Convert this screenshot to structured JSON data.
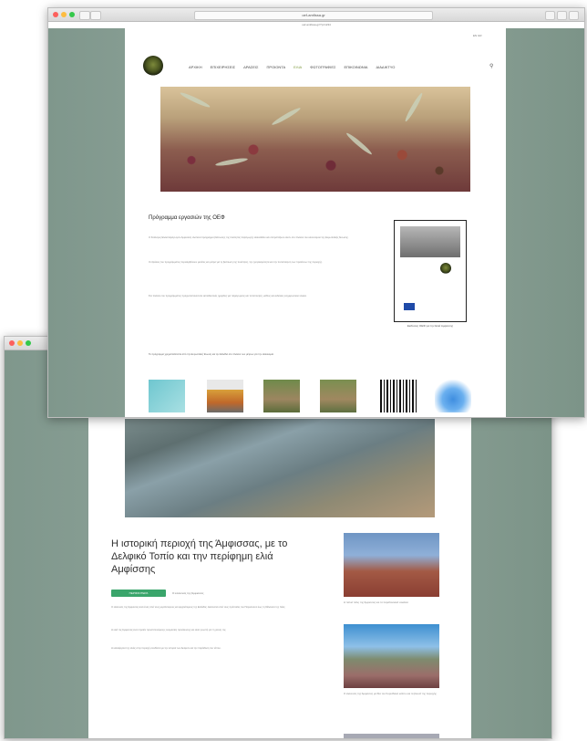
{
  "windows": {
    "front": {
      "url": "oef-amfissa.gr",
      "subtitle": "oef-amfissa.gr/?p=1234"
    },
    "back": {
      "url": ""
    }
  },
  "front_page": {
    "lang": "EN GR",
    "menu": [
      "ΑΡΧΙΚΗ",
      "ΕΠΙΧΕΙΡΗΣΕΙΣ",
      "ΔΡΑΣΕΙΣ",
      "ΠΡΟΙΟΝΤΑ",
      "ΕΛΙΑ",
      "ΦΩΤΟΓΡΑΦΙΕΣ",
      "ΕΠΙΚΟΙΝΩΝΙΑ",
      "ΔΙΑΔΙΚΤΥΟ"
    ],
    "title": "Πρόγραμμα εργασιών της ΟΕΦ",
    "paragraphs": [
      "Ο Σύλλογος Ελαιοπαραγωγών Αμφισσας υλοποιεί πρόγραμμα βελτίωσης της ποιότητας παραγωγής ελαιολάδου και επιτραπέζιων ελιών στο πλαίσιο του κανονισμού της Ευρωπαϊκής Ένωσης.",
      "Οι δράσεις του προγράμματος περιλαμβάνουν μελέτες και μέτρα για τη βελτίωση της ποιότητας, την ιχνηλασιμότητα και την πιστοποίηση των προϊόντων της περιοχής.",
      "Στο πλαίσιο του προγράμματος πραγματοποιούνται εκπαιδευτικές ημερίδες για παραγωγούς και τυποποιητές, καθώς και εκδόσεις ενημερωτικού υλικού."
    ],
    "book_caption": "Εκδόσεις ΟΕΦ για την Ελιά Αμφίσσης",
    "note": "Το πρόγραμμα χρηματοδοτείται από την Ευρωπαϊκή Ένωση και την Ελλάδα στο πλαίσιο των μέτρων για την ελαιοκομία."
  },
  "back_page": {
    "title": "Η ιστορική περιοχή της Άμφισσας, με το Δελφικό Τοπίο και την περίφημη ελιά Αμφίσσης",
    "button_label": "ΠΕΡΙΣΣΟΤΕΡΑ",
    "meta": "Ο ελαιώνας της Άμφισσας",
    "paragraphs": [
      "Ο ελαιώνας της Άμφισσας είναι ένας από τους μεγαλύτερους και αρχαιότερους της Ελλάδας. Εκτείνεται από τους πρόποδες του Παρνασσού έως τη θάλασσα της Ιτέας.",
      "Η ελιά της Άμφισσας είναι προϊόν προστατευόμενης ονομασίας προέλευσης και είναι γνωστή για τη γεύση της.",
      "Η καλλιέργεια της ελιάς στην περιοχή συνδέεται με την ιστορία των Δελφών και την παράδοση του τόπου."
    ],
    "side_captions": [
      "Η παλιά πόλη της Άμφισσας και τα παραδοσιακά σοκάκια",
      "Ο ελαιώνας της Άμφισσας με θέα τον Κορινθιακό κόλπο και τα βουνά της περιοχής"
    ]
  }
}
